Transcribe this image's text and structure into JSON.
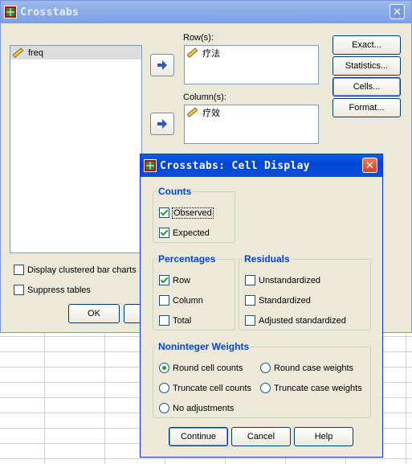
{
  "crosstabs": {
    "title": "Crosstabs",
    "variables": [
      {
        "name": "freq"
      }
    ],
    "rows_label": "Row(s):",
    "rows": [
      {
        "name": "疗法"
      }
    ],
    "columns_label": "Column(s):",
    "columns": [
      {
        "name": "疗效"
      }
    ],
    "buttons": {
      "exact": "Exact...",
      "statistics": "Statistics...",
      "cells": "Cells...",
      "format": "Format...",
      "ok": "OK"
    },
    "display_clustered": {
      "label": "Display clustered bar charts",
      "checked": false
    },
    "suppress_tables": {
      "label": "Suppress tables",
      "checked": false
    }
  },
  "cell_display": {
    "title": "Crosstabs: Cell Display",
    "counts": {
      "title": "Counts",
      "observed": {
        "label": "Observed",
        "checked": true
      },
      "expected": {
        "label": "Expected",
        "checked": true
      }
    },
    "percentages": {
      "title": "Percentages",
      "row": {
        "label": "Row",
        "checked": true
      },
      "column": {
        "label": "Column",
        "checked": false
      },
      "total": {
        "label": "Total",
        "checked": false
      }
    },
    "residuals": {
      "title": "Residuals",
      "unstandardized": {
        "label": "Unstandardized",
        "checked": false
      },
      "standardized": {
        "label": "Standardized",
        "checked": false
      },
      "adjusted": {
        "label": "Adjusted standardized",
        "checked": false
      }
    },
    "noninteger": {
      "title": "Noninteger Weights",
      "round_cell": {
        "label": "Round cell counts",
        "selected": true
      },
      "round_case": {
        "label": "Round case weights",
        "selected": false
      },
      "truncate_cell": {
        "label": "Truncate cell counts",
        "selected": false
      },
      "truncate_case": {
        "label": "Truncate case weights",
        "selected": false
      },
      "no_adjust": {
        "label": "No adjustments",
        "selected": false
      }
    },
    "buttons": {
      "continue": "Continue",
      "cancel": "Cancel",
      "help": "Help"
    }
  },
  "colors": {
    "title_active": "#0a50dc",
    "group_title": "#0046d5",
    "dialog_bg": "#ece9d8"
  }
}
